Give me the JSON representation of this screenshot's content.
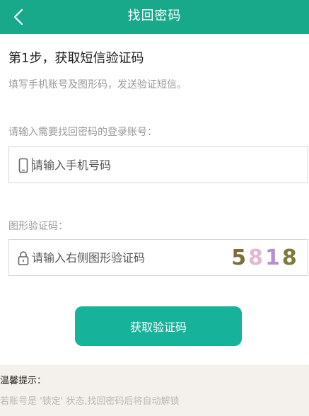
{
  "header": {
    "title": "找回密码",
    "back_icon": "chevron-left-icon",
    "background": "#17a98a"
  },
  "step": {
    "title": "第1步，获取短信验证码",
    "description": "填写手机账号及图形码，发送验证短信。"
  },
  "account": {
    "label": "请输入需要找回密码的登录账号：",
    "icon": "phone-icon",
    "value": "",
    "placeholder": "请输入手机号码"
  },
  "captcha": {
    "label": "图形验证码：",
    "icon": "lock-icon",
    "value": "",
    "placeholder": "请输入右侧图形验证码",
    "image": {
      "chars": [
        "5",
        "8",
        "1",
        "8"
      ],
      "colors": [
        "#7e6f3a",
        "#e4b7cf",
        "#b48fd2",
        "#7a7a3c"
      ]
    }
  },
  "submit": {
    "label": "获取验证码",
    "color": "#17b29a"
  },
  "tips": {
    "title": "温馨提示：",
    "text": "若账号是 '锁定' 状态,找回密码后将自动解锁"
  }
}
